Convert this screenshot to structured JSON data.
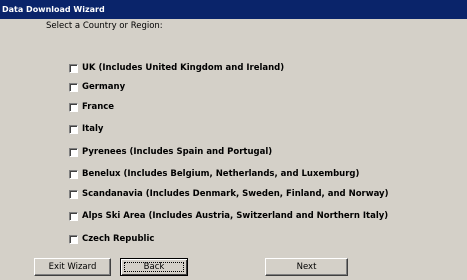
{
  "window": {
    "title": "Data Download Wizard"
  },
  "prompt": "Select a Country or Region:",
  "options": [
    {
      "label": "UK (Includes United Kingdom and Ireland)",
      "checked": false
    },
    {
      "label": "Germany",
      "checked": false
    },
    {
      "label": "France",
      "checked": false
    },
    {
      "label": "Italy",
      "checked": false
    },
    {
      "label": "Pyrenees (Includes Spain and Portugal)",
      "checked": false
    },
    {
      "label": "Benelux (Includes Belgium, Netherlands, and Luxemburg)",
      "checked": false
    },
    {
      "label": "Scandanavia (Includes Denmark, Sweden, Finland, and Norway)",
      "checked": false
    },
    {
      "label": "Alps Ski Area (Includes Austria, Switzerland and Northern Italy)",
      "checked": false
    },
    {
      "label": "Czech Republic",
      "checked": false
    }
  ],
  "buttons": {
    "exit": "Exit Wizard",
    "back": "Back",
    "next": "Next"
  }
}
